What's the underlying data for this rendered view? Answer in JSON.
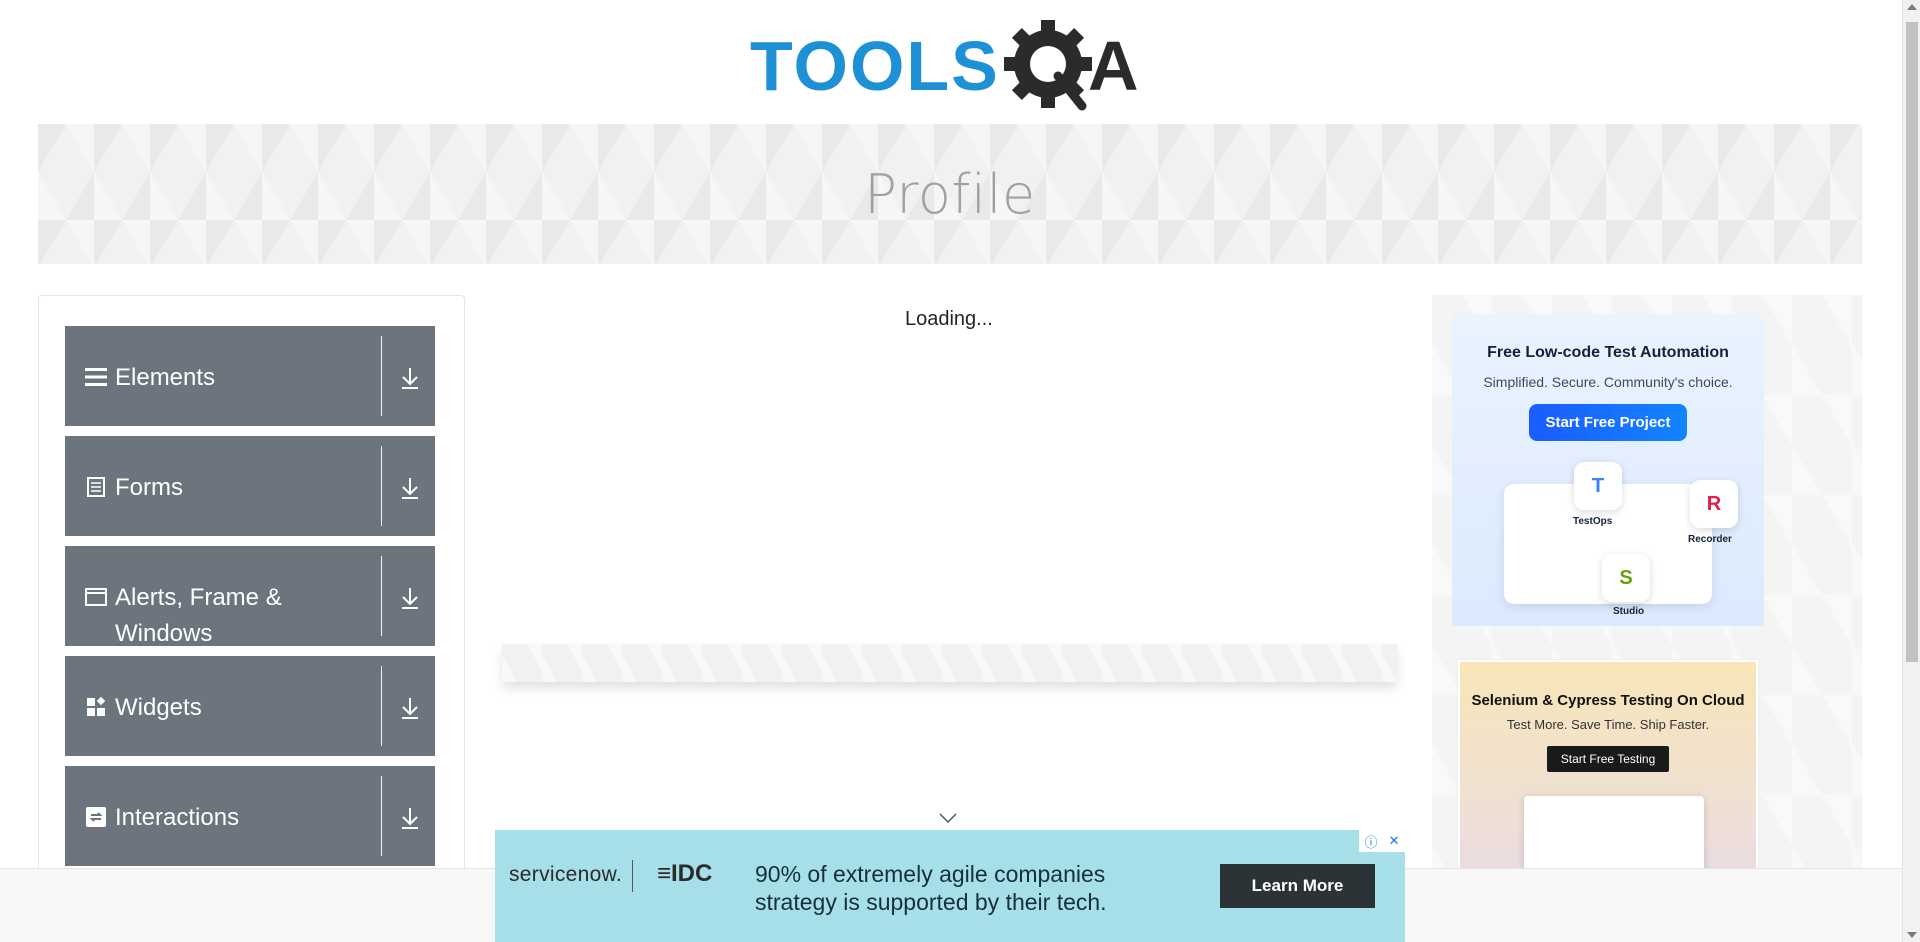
{
  "header": {
    "logo_text_main": "TOOLS",
    "logo_text_accent": "QA",
    "logo_colors": {
      "tools": "#1e90d6",
      "qa": "#2b2b2b"
    }
  },
  "banner": {
    "title": "Profile"
  },
  "sidebar": {
    "groups": [
      {
        "label": "Elements",
        "icon": "hamburger-icon"
      },
      {
        "label": "Forms",
        "icon": "document-icon"
      },
      {
        "label": "Alerts, Frame & Windows",
        "icon": "window-icon"
      },
      {
        "label": "Widgets",
        "icon": "widgets-icon"
      },
      {
        "label": "Interactions",
        "icon": "interactions-icon"
      }
    ],
    "group_color": "#6c757d"
  },
  "main": {
    "loading_text": "Loading..."
  },
  "ads": {
    "ad1": {
      "title": "Free Low-code Test Automation",
      "subtitle": "Simplified. Secure. Community's choice.",
      "button": "Start Free Project",
      "apps": [
        {
          "letter": "T",
          "caption": "TestOps",
          "color": "#3b82f6"
        },
        {
          "letter": "R",
          "caption": "Recorder",
          "color": "#e11d48"
        },
        {
          "letter": "S",
          "caption": "Studio",
          "color": "#65a30d"
        }
      ]
    },
    "ad2": {
      "title": "Selenium & Cypress Testing On Cloud",
      "subtitle": "Test More. Save Time. Ship Faster.",
      "button": "Start Free Testing"
    },
    "bottom": {
      "brand": "servicenow.",
      "partner": "IDC",
      "message": "90% of extremely agile companies strategy is supported by their tech.",
      "button": "Learn More",
      "info_icon": "info-icon",
      "close_icon": "close-icon"
    }
  }
}
